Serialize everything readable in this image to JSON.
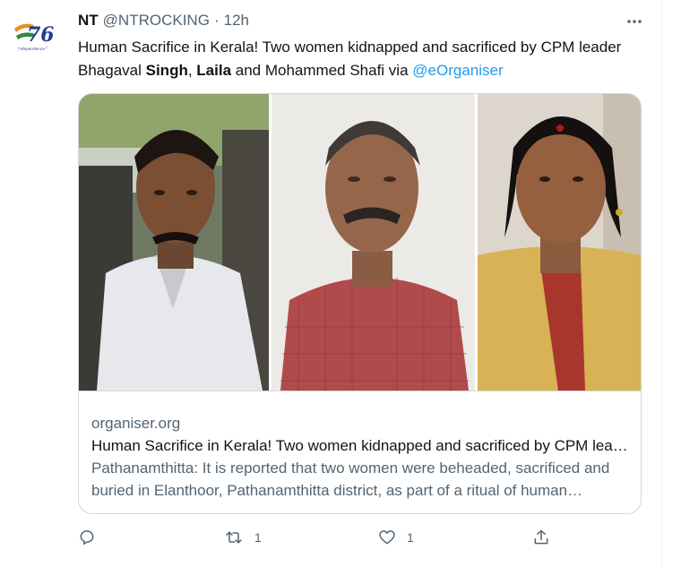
{
  "tweet": {
    "author_name": "NT",
    "handle": "@NTROCKING",
    "separator": "·",
    "time": "12h",
    "text_parts": [
      "Human Sacrifice in Kerala! Two women kidnapped and sacrificed by CPM leader Bhagaval ",
      "Singh",
      ", ",
      "Laila",
      " and Mohammed Shafi via ",
      "@eOrganiser"
    ]
  },
  "avatar": {
    "badge_text": "76",
    "caption": "Independence Day"
  },
  "card": {
    "domain": "organiser.org",
    "title": "Human Sacrifice in Kerala! Two women kidnapped and sacrificed by CPM leader Bhagaval Singh, Laila and Mohammed Shafi",
    "description": "Pathanamthitta: It is reported that two women were beheaded, sacrificed and buried in Elanthoor, Pathanamthitta district, as part of a ritual of human sacrifice..."
  },
  "actions": {
    "reply_count": "",
    "retweet_count": "1",
    "like_count": "1"
  },
  "colors": {
    "accent": "#1d9bf0",
    "secondary_text": "#536471",
    "border": "#cfd9de"
  }
}
